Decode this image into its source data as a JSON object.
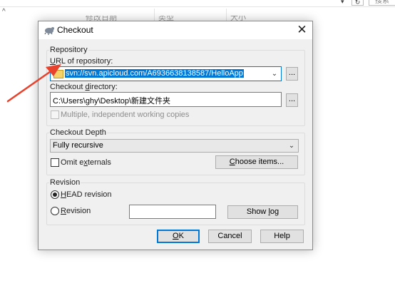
{
  "background": {
    "columns": [
      "修改日期",
      "类型",
      "大小"
    ],
    "search_label": "搜索"
  },
  "dialog": {
    "title": "Checkout",
    "repository": {
      "group_label": "Repository",
      "url_label_access": "U",
      "url_label_rest": "RL of repository:",
      "url_value": "svn://svn.apicloud.com/A6936638138587/HelloApp",
      "dir_label_pre": "Checkout ",
      "dir_label_access": "d",
      "dir_label_rest": "irectory:",
      "dir_value": "C:\\Users\\ghy\\Desktop\\新建文件夹",
      "multiple_label": "Multiple, independent working copies",
      "browse_label": "..."
    },
    "depth": {
      "group_label": "Checkout Depth",
      "value": "Fully recursive",
      "omit_pre": "Omit e",
      "omit_access": "x",
      "omit_rest": "ternals",
      "choose_access": "C",
      "choose_rest": "hoose items..."
    },
    "revision": {
      "group_label": "Revision",
      "head_access": "H",
      "head_rest": "EAD revision",
      "rev_access": "R",
      "rev_rest": "evision",
      "rev_value": "",
      "showlog_pre": "Show ",
      "showlog_access": "l",
      "showlog_rest": "og"
    },
    "buttons": {
      "ok_access": "O",
      "ok_rest": "K",
      "cancel": "Cancel",
      "help": "Help"
    }
  },
  "colors": {
    "accent": "#0078d7",
    "arrow": "#e8412c",
    "dialog_bg": "#f0f0f0"
  }
}
